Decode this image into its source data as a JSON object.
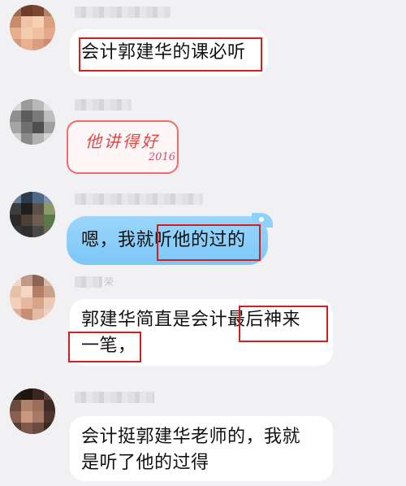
{
  "messages": [
    {
      "text": "会计郭建华的课必听"
    },
    {
      "sticker_text": "他讲得好",
      "sticker_year": "2016"
    },
    {
      "text": "嗯，我就听他的过的"
    },
    {
      "sender_visible_char": "荣",
      "lines": [
        "郭建华简直是会计最后神来",
        "一笔，"
      ]
    },
    {
      "lines": [
        "会计挺郭建华老师的，我就",
        "是听了他的过得"
      ]
    }
  ],
  "colors": {
    "background": "#f1f1f3",
    "bubble": "#ffffff",
    "blue_bubble": "#86cdf8",
    "highlight_box": "#cf2020",
    "sticker_red": "#e24646"
  }
}
